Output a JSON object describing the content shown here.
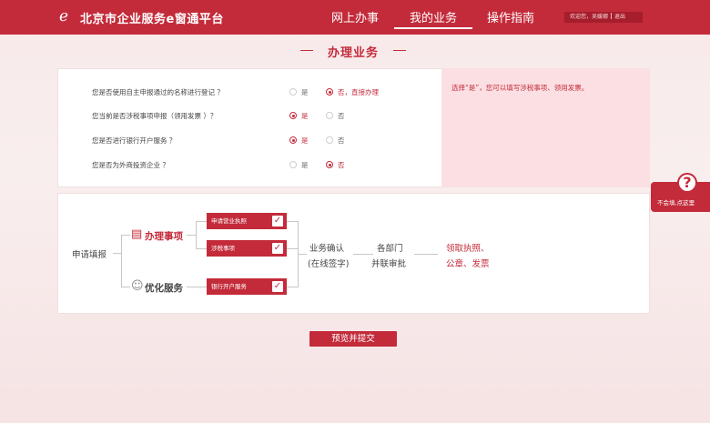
{
  "header": {
    "logo_glyph": "ℯ",
    "title": "北京市企业服务e窗通平台",
    "nav": [
      "网上办事",
      "我的业务",
      "操作指南"
    ],
    "active_nav": "我的业务",
    "user": {
      "greeting": "欢迎您，吴媛娜",
      "logout": "退出"
    }
  },
  "section_title": "办理业务",
  "questions": [
    {
      "label": "您是否使用自主申报通过的名称进行登记 ？",
      "options": [
        "是",
        "否，直接办理"
      ],
      "selected": 1
    },
    {
      "label": "您当前是否涉税事项申报（领用发票 ）？",
      "options": [
        "是",
        "否"
      ],
      "selected": 0
    },
    {
      "label": "您是否进行银行开户服务 ？",
      "options": [
        "是",
        "否"
      ],
      "selected": 0
    },
    {
      "label": "您是否为外商投资企业 ？",
      "options": [
        "是",
        "否"
      ],
      "selected": 1
    }
  ],
  "hint": "选择“是”，您可以填写涉税事项、领用发票。",
  "flow": {
    "start": "申请填报",
    "group1": {
      "title": "办理事项",
      "icon": "document-icon",
      "items": [
        "申请营业执照",
        "涉税事项"
      ]
    },
    "group2": {
      "title": "优化服务",
      "icon": "service-person-icon",
      "items": [
        "银行开户服务"
      ]
    },
    "step_confirm": [
      "业务确认",
      "(在线签字)"
    ],
    "step_review": [
      "各部门",
      "并联审批"
    ],
    "step_receive": [
      "领取执照、",
      "公章、发票"
    ]
  },
  "submit_label": "预览并提交",
  "help": {
    "icon": "question-icon",
    "text": "不会填,点这里"
  },
  "colors": {
    "brand": "#c32b3a",
    "hint_bg": "#fbdfe2"
  }
}
